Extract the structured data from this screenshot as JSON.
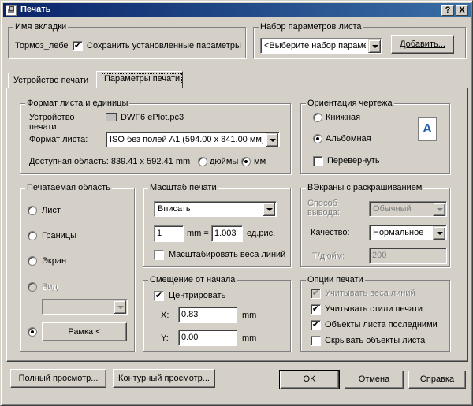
{
  "window": {
    "title": "Печать",
    "help_btn": "?",
    "close_btn": "X"
  },
  "tab_name_group": {
    "title": "Имя вкладки",
    "tab_value": "Тормоз_лебе",
    "save_checked": true,
    "save_label": "Сохранить установленные параметры"
  },
  "page_setup_group": {
    "title": "Набор параметров листа",
    "select_value": "<Выберите набор парамет",
    "add_button": "Добавить..."
  },
  "tabs": [
    {
      "label": "Устройство печати",
      "active": false
    },
    {
      "label": "Параметры печати",
      "active": true
    }
  ],
  "format_group": {
    "title": "Формат листа и единицы",
    "device_label": "Устройство печати:",
    "device_value": "DWF6 ePlot.pc3",
    "format_label": "Формат листа:",
    "format_value": "ISO без полей A1 (594.00 x 841.00 мм)",
    "area_text": "Доступная область: 839.41 x 592.41 mm",
    "units": [
      {
        "label": "дюймы",
        "selected": false
      },
      {
        "label": "мм",
        "selected": true
      }
    ]
  },
  "orientation_group": {
    "title": "Ориентация чертежа",
    "portrait_label": "Книжная",
    "portrait_selected": false,
    "landscape_label": "Альбомная",
    "landscape_selected": true,
    "flip_label": "Перевернуть",
    "flip_checked": false,
    "icon_letter": "A"
  },
  "area_group": {
    "title": "Печатаемая область",
    "options": [
      {
        "label": "Лист",
        "selected": false,
        "disabled": false
      },
      {
        "label": "Границы",
        "selected": false,
        "disabled": false
      },
      {
        "label": "Экран",
        "selected": false,
        "disabled": false
      },
      {
        "label": "Вид",
        "selected": false,
        "disabled": true
      },
      {
        "label": "Рамка",
        "selected": true,
        "disabled": false
      }
    ],
    "frame_button": "Рамка <"
  },
  "scale_group": {
    "title": "Масштаб печати",
    "fit_value": "Вписать",
    "mm_value": "1",
    "mm_unit": "mm =",
    "units_value": "1.003",
    "units_label": "ед.рис.",
    "scale_lineweights_label": "Масштабировать веса линий",
    "scale_lineweights_checked": false
  },
  "offset_group": {
    "title": "Смещение от начала",
    "center_label": "Центрировать",
    "center_checked": true,
    "x_label": "X:",
    "x_value": "0.83",
    "x_unit": "mm",
    "y_label": "Y:",
    "y_value": "0.00",
    "y_unit": "mm"
  },
  "shaded_group": {
    "title": "ВЭкраны с раскрашиванием",
    "output_label": "Способ вывода:",
    "output_value": "Обычный",
    "quality_label": "Качество:",
    "quality_value": "Нормальное",
    "dpi_label": "Т/дюйм:",
    "dpi_value": "200"
  },
  "options_group": {
    "title": "Опции печати",
    "items": [
      {
        "label": "Учитывать веса линий",
        "checked": true,
        "disabled": true
      },
      {
        "label": "Учитывать стили печати",
        "checked": true,
        "disabled": false
      },
      {
        "label": "Объекты листа последними",
        "checked": true,
        "disabled": false
      },
      {
        "label": "Скрывать объекты листа",
        "checked": false,
        "disabled": false
      }
    ]
  },
  "footer": {
    "full_preview": "Полный просмотр...",
    "partial_preview": "Контурный просмотр...",
    "ok": "OK",
    "cancel": "Отмена",
    "help": "Справка"
  },
  "check_mark": "✔"
}
